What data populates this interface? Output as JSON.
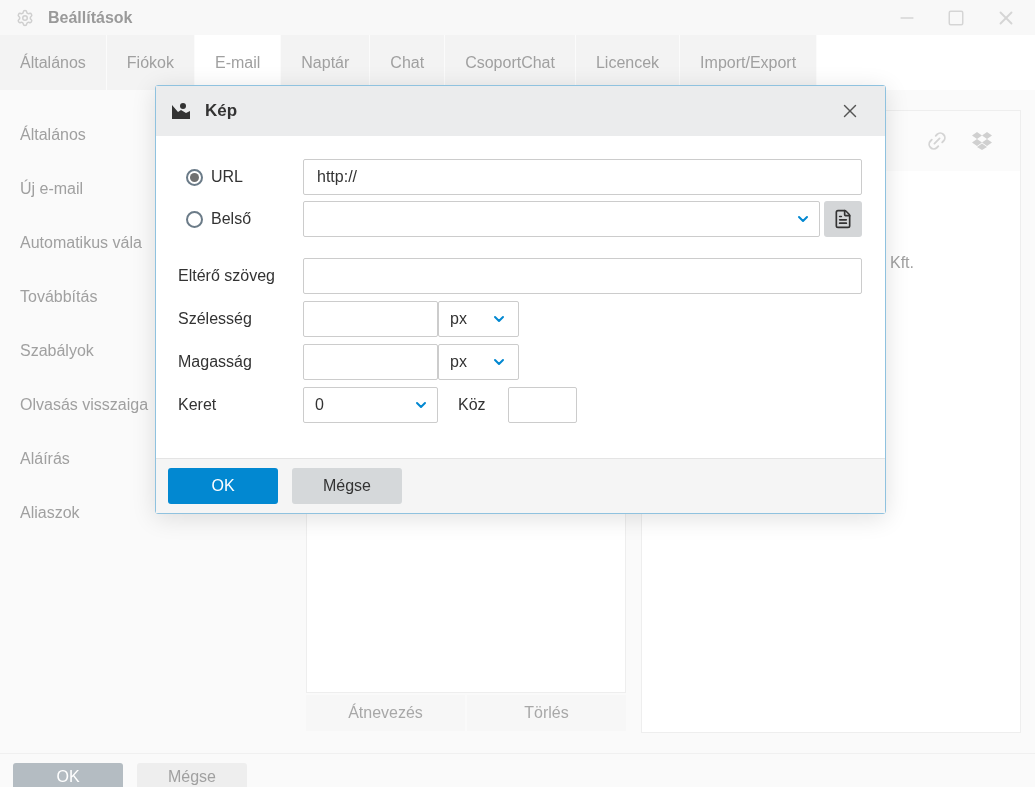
{
  "window": {
    "title": "Beállítások"
  },
  "tabs": [
    {
      "label": "Általános",
      "selected": false
    },
    {
      "label": "Fiókok",
      "selected": false
    },
    {
      "label": "E-mail",
      "selected": true
    },
    {
      "label": "Naptár",
      "selected": false
    },
    {
      "label": "Chat",
      "selected": false
    },
    {
      "label": "CsoportChat",
      "selected": false
    },
    {
      "label": "Licencek",
      "selected": false
    },
    {
      "label": "Import/Export",
      "selected": false
    }
  ],
  "sidebar": {
    "items": [
      "Általános",
      "Új e-mail",
      "Automatikus vála",
      "Továbbítás",
      "Szabályok",
      "Olvasás visszaiga",
      "Aláírás",
      "Aliaszok"
    ]
  },
  "list_buttons": [
    "Átnevezés",
    "Törlés"
  ],
  "preview": {
    "text": "Kft."
  },
  "footer": {
    "buttons": [
      "OK",
      "Mégse"
    ]
  },
  "dialog": {
    "title": "Kép",
    "source": [
      {
        "label": "URL",
        "selected": true,
        "kind": "text",
        "value": "http://"
      },
      {
        "label": "Belső",
        "selected": false,
        "kind": "select"
      }
    ],
    "alt_text": {
      "label": "Eltérő szöveg"
    },
    "size": [
      {
        "label": "Szélesség",
        "unit": "px"
      },
      {
        "label": "Magasság",
        "unit": "px"
      }
    ],
    "border": {
      "label": "Keret",
      "value": "0"
    },
    "spacing": {
      "label": "Köz"
    },
    "buttons": [
      {
        "label": "OK",
        "kind": "primary"
      },
      {
        "label": "Mégse",
        "kind": "secondary"
      }
    ]
  }
}
